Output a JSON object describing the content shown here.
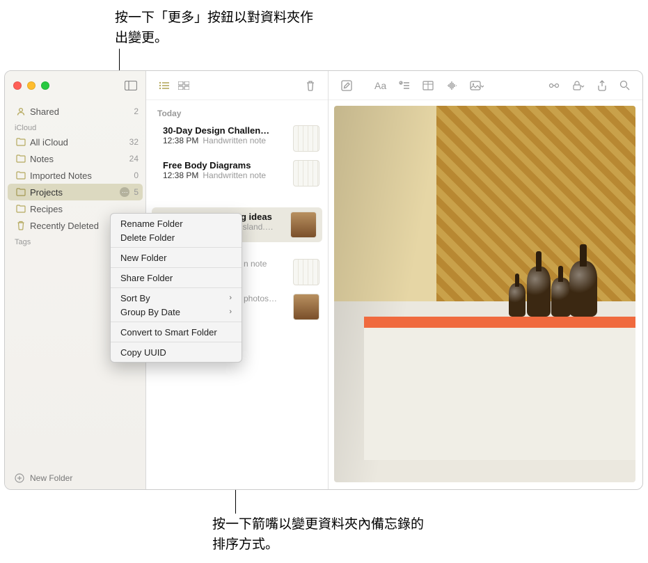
{
  "callouts": {
    "top": "按一下「更多」按鈕以對資料夾作出變更。",
    "bottom": "按一下箭嘴以變更資料夾內備忘錄的排序方式。"
  },
  "sidebar": {
    "shared_label": "Shared",
    "shared_count": "2",
    "section_icloud": "iCloud",
    "section_tags": "Tags",
    "items": [
      {
        "label": "All iCloud",
        "count": "32"
      },
      {
        "label": "Notes",
        "count": "24"
      },
      {
        "label": "Imported Notes",
        "count": "0"
      },
      {
        "label": "Projects",
        "count": "5"
      },
      {
        "label": "Recipes",
        "count": ""
      },
      {
        "label": "Recently Deleted",
        "count": ""
      }
    ],
    "footer_label": "New Folder"
  },
  "notes": {
    "header_today": "Today",
    "rows": [
      {
        "title": "30-Day Design Challen…",
        "time": "12:38 PM",
        "snippet": "Handwritten note"
      },
      {
        "title": "Free Body Diagrams",
        "time": "12:38 PM",
        "snippet": "Handwritten note"
      },
      {
        "title": "g ideas",
        "time": "",
        "snippet": "island.…"
      },
      {
        "title": "",
        "time": "",
        "snippet": "n note"
      },
      {
        "title": "",
        "time": "",
        "snippet": "photos…"
      }
    ]
  },
  "context_menu": {
    "rename": "Rename Folder",
    "delete": "Delete Folder",
    "new": "New Folder",
    "share": "Share Folder",
    "sort": "Sort By",
    "group": "Group By Date",
    "convert": "Convert to Smart Folder",
    "copy": "Copy UUID"
  }
}
